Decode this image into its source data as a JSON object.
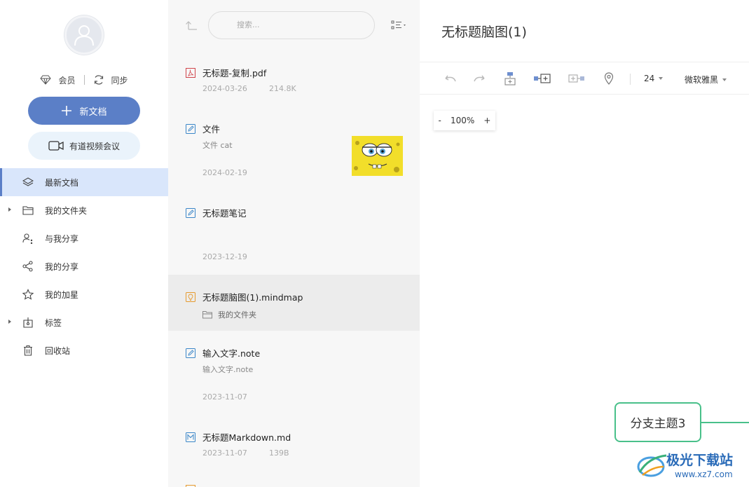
{
  "sidebar": {
    "account": {
      "vip_label": "会员",
      "sync_label": "同步"
    },
    "new_doc_label": "新文档",
    "meeting_label": "有道视频会议",
    "nav": [
      {
        "label": "最新文档",
        "icon": "layers-icon",
        "active": true,
        "expandable": false
      },
      {
        "label": "我的文件夹",
        "icon": "folder-icon",
        "active": false,
        "expandable": true
      },
      {
        "label": "与我分享",
        "icon": "user-share-icon",
        "active": false,
        "expandable": false
      },
      {
        "label": "我的分享",
        "icon": "share-icon",
        "active": false,
        "expandable": false
      },
      {
        "label": "我的加星",
        "icon": "star-icon",
        "active": false,
        "expandable": false
      },
      {
        "label": "标签",
        "icon": "tag-icon",
        "active": false,
        "expandable": true
      },
      {
        "label": "回收站",
        "icon": "trash-icon",
        "active": false,
        "expandable": false
      }
    ]
  },
  "filelist": {
    "search_placeholder": "搜索...",
    "files": [
      {
        "name": "无标题-复制.pdf",
        "type": "pdf",
        "date": "2024-03-26",
        "size": "214.8K"
      },
      {
        "name": "文件",
        "type": "note",
        "preview": "文件 cat",
        "date": "2024-02-19",
        "has_thumbnail": true
      },
      {
        "name": "无标题笔记",
        "type": "note",
        "date": "2023-12-19"
      },
      {
        "name": "无标题脑图(1).mindmap",
        "type": "mindmap",
        "folder": "我的文件夹",
        "active": true
      },
      {
        "name": "输入文字.note",
        "type": "note",
        "preview": "输入文字.note",
        "date": "2023-11-07"
      },
      {
        "name": "无标题Markdown.md",
        "type": "markdown",
        "date": "2023-11-07",
        "size": "139B"
      }
    ]
  },
  "editor": {
    "title": "无标题脑图(1)",
    "font_size": "24",
    "font_family": "微软雅黑",
    "zoom": {
      "minus": "-",
      "value": "100%",
      "plus": "+"
    },
    "node_label": "分支主题3"
  },
  "watermark": {
    "text": "极光下载站",
    "url": "www.xz7.com"
  },
  "colors": {
    "accent": "#5b7fc7",
    "active_nav_bg": "#d9e6fb",
    "node_border": "#49c08a",
    "meeting_bg": "#eaf3fb"
  }
}
